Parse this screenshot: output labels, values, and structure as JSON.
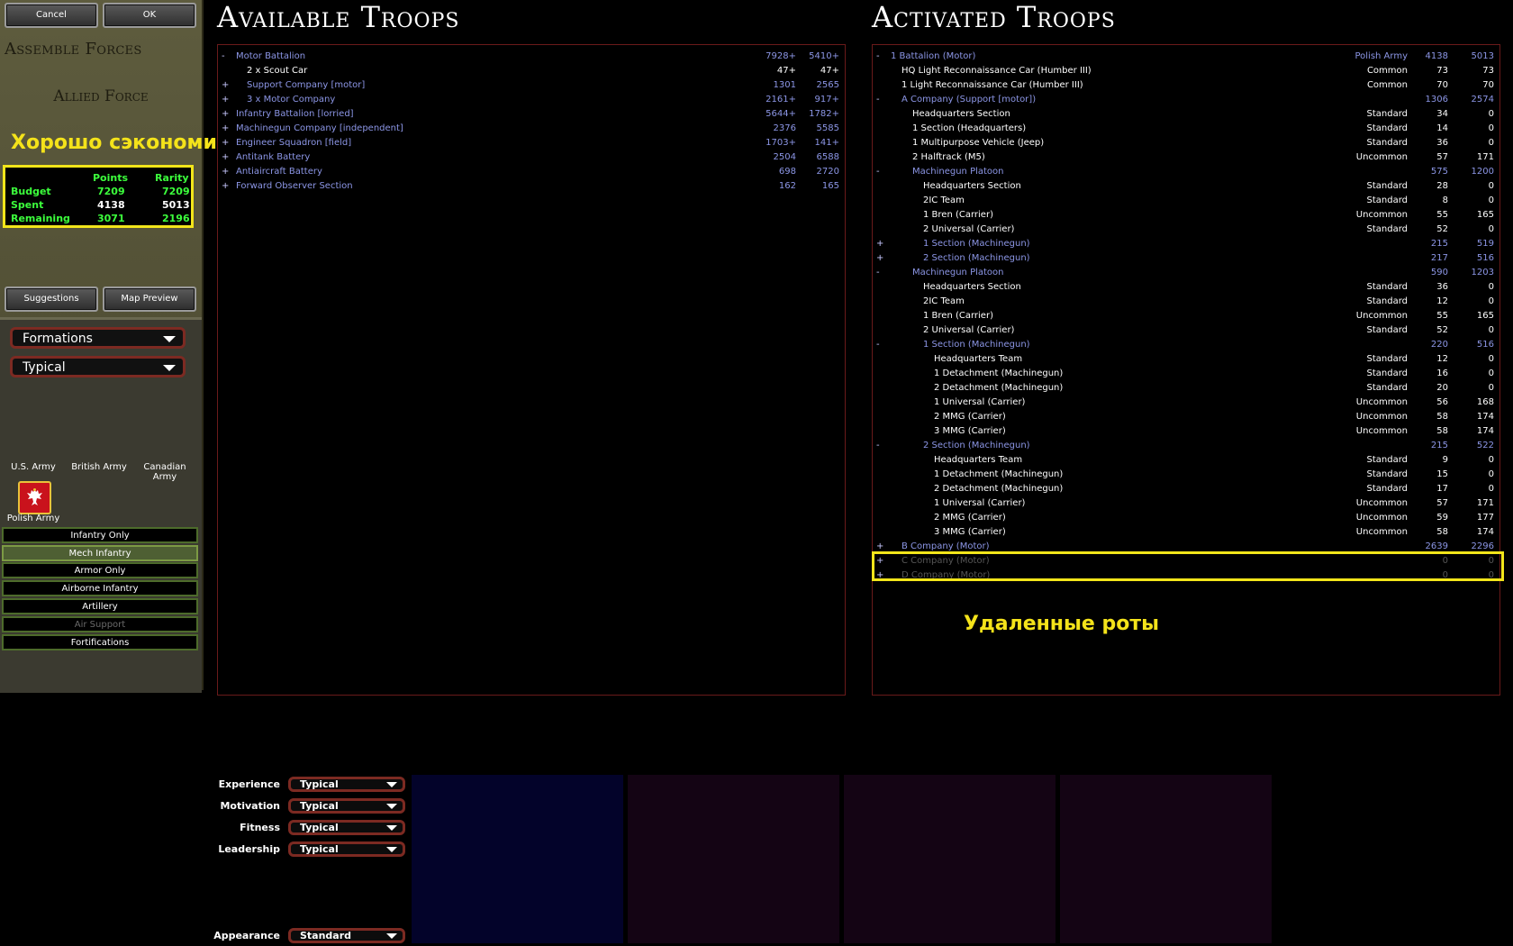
{
  "buttons": {
    "cancel": "Cancel",
    "ok": "OK",
    "suggestions": "Suggestions",
    "map_preview": "Map Preview"
  },
  "left": {
    "assemble_title": "Assemble Forces",
    "force_title": "Allied Force",
    "budget": {
      "col_points": "Points",
      "col_rarity": "Rarity",
      "rows": [
        {
          "label": "Budget",
          "points": "7209",
          "rarity": "7209"
        },
        {
          "label": "Spent",
          "points": "4138",
          "rarity": "5013"
        },
        {
          "label": "Remaining",
          "points": "3071",
          "rarity": "2196"
        }
      ]
    },
    "dropdown_type": "Formations",
    "dropdown_quality": "Typical",
    "armies": [
      "U.S. Army",
      "British Army",
      "Canadian Army",
      "Polish Army"
    ],
    "categories": [
      "Infantry Only",
      "Mech Infantry",
      "Armor Only",
      "Airborne Infantry",
      "Artillery",
      "Air Support",
      "Fortifications"
    ]
  },
  "overlays": {
    "saved": "Хорошо сэкономили",
    "deleted": "Удаленные роты"
  },
  "available": {
    "title": "Available Troops",
    "rows": [
      {
        "sign": "-",
        "indent": 0,
        "name": "Motor Battalion",
        "v1": "7928+",
        "v2": "5410+",
        "style": "blue"
      },
      {
        "sign": "",
        "indent": 1,
        "name": "2 x Scout Car",
        "v1": "47+",
        "v2": "47+",
        "style": "lt"
      },
      {
        "sign": "+",
        "indent": 1,
        "name": "Support Company [motor]",
        "v1": "1301",
        "v2": "2565",
        "style": "blue"
      },
      {
        "sign": "+",
        "indent": 1,
        "name": "3 x Motor Company",
        "v1": "2161+",
        "v2": "917+",
        "style": "blue"
      },
      {
        "sign": "+",
        "indent": 0,
        "name": "Infantry Battalion [lorried]",
        "v1": "5644+",
        "v2": "1782+",
        "style": "blue"
      },
      {
        "sign": "+",
        "indent": 0,
        "name": "Machinegun Company [independent]",
        "v1": "2376",
        "v2": "5585",
        "style": "blue"
      },
      {
        "sign": "+",
        "indent": 0,
        "name": "Engineer Squadron [field]",
        "v1": "1703+",
        "v2": "141+",
        "style": "blue"
      },
      {
        "sign": "+",
        "indent": 0,
        "name": "Antitank Battery",
        "v1": "2504",
        "v2": "6588",
        "style": "blue"
      },
      {
        "sign": "+",
        "indent": 0,
        "name": "Antiaircraft Battery",
        "v1": "698",
        "v2": "2720",
        "style": "blue"
      },
      {
        "sign": "+",
        "indent": 0,
        "name": "Forward Observer Section",
        "v1": "162",
        "v2": "165",
        "style": "blue"
      }
    ]
  },
  "activated": {
    "title": "Activated Troops",
    "rows": [
      {
        "sign": "-",
        "indent": 0,
        "name": "1 Battalion (Motor)",
        "rarity": "Polish Army",
        "v1": "4138",
        "v2": "5013",
        "style": "blue"
      },
      {
        "sign": "",
        "indent": 1,
        "name": "HQ Light Reconnaissance Car (Humber III)",
        "rarity": "Common",
        "v1": "73",
        "v2": "73",
        "style": "lt"
      },
      {
        "sign": "",
        "indent": 1,
        "name": "1 Light Reconnaissance Car (Humber III)",
        "rarity": "Common",
        "v1": "70",
        "v2": "70",
        "style": "lt"
      },
      {
        "sign": "-",
        "indent": 1,
        "name": "A Company (Support [motor])",
        "rarity": "",
        "v1": "1306",
        "v2": "2574",
        "style": "blue"
      },
      {
        "sign": "",
        "indent": 2,
        "name": "Headquarters Section",
        "rarity": "Standard",
        "v1": "34",
        "v2": "0",
        "style": "lt"
      },
      {
        "sign": "",
        "indent": 2,
        "name": "1 Section (Headquarters)",
        "rarity": "Standard",
        "v1": "14",
        "v2": "0",
        "style": "lt"
      },
      {
        "sign": "",
        "indent": 2,
        "name": "1 Multipurpose Vehicle (Jeep)",
        "rarity": "Standard",
        "v1": "36",
        "v2": "0",
        "style": "lt"
      },
      {
        "sign": "",
        "indent": 2,
        "name": "2 Halftrack (M5)",
        "rarity": "Uncommon",
        "v1": "57",
        "v2": "171",
        "style": "lt"
      },
      {
        "sign": "-",
        "indent": 2,
        "name": "Machinegun Platoon",
        "rarity": "",
        "v1": "575",
        "v2": "1200",
        "style": "blue"
      },
      {
        "sign": "",
        "indent": 3,
        "name": "Headquarters Section",
        "rarity": "Standard",
        "v1": "28",
        "v2": "0",
        "style": "lt"
      },
      {
        "sign": "",
        "indent": 3,
        "name": "2IC Team",
        "rarity": "Standard",
        "v1": "8",
        "v2": "0",
        "style": "lt"
      },
      {
        "sign": "",
        "indent": 3,
        "name": "1 Bren (Carrier)",
        "rarity": "Uncommon",
        "v1": "55",
        "v2": "165",
        "style": "lt"
      },
      {
        "sign": "",
        "indent": 3,
        "name": "2 Universal (Carrier)",
        "rarity": "Standard",
        "v1": "52",
        "v2": "0",
        "style": "lt"
      },
      {
        "sign": "+",
        "indent": 3,
        "name": "1 Section (Machinegun)",
        "rarity": "",
        "v1": "215",
        "v2": "519",
        "style": "blue"
      },
      {
        "sign": "+",
        "indent": 3,
        "name": "2 Section (Machinegun)",
        "rarity": "",
        "v1": "217",
        "v2": "516",
        "style": "blue"
      },
      {
        "sign": "-",
        "indent": 2,
        "name": "Machinegun Platoon",
        "rarity": "",
        "v1": "590",
        "v2": "1203",
        "style": "blue"
      },
      {
        "sign": "",
        "indent": 3,
        "name": "Headquarters Section",
        "rarity": "Standard",
        "v1": "36",
        "v2": "0",
        "style": "lt"
      },
      {
        "sign": "",
        "indent": 3,
        "name": "2IC Team",
        "rarity": "Standard",
        "v1": "12",
        "v2": "0",
        "style": "lt"
      },
      {
        "sign": "",
        "indent": 3,
        "name": "1 Bren (Carrier)",
        "rarity": "Uncommon",
        "v1": "55",
        "v2": "165",
        "style": "lt"
      },
      {
        "sign": "",
        "indent": 3,
        "name": "2 Universal (Carrier)",
        "rarity": "Standard",
        "v1": "52",
        "v2": "0",
        "style": "lt"
      },
      {
        "sign": "-",
        "indent": 3,
        "name": "1 Section (Machinegun)",
        "rarity": "",
        "v1": "220",
        "v2": "516",
        "style": "blue"
      },
      {
        "sign": "",
        "indent": 4,
        "name": "Headquarters Team",
        "rarity": "Standard",
        "v1": "12",
        "v2": "0",
        "style": "lt"
      },
      {
        "sign": "",
        "indent": 4,
        "name": "1 Detachment (Machinegun)",
        "rarity": "Standard",
        "v1": "16",
        "v2": "0",
        "style": "lt"
      },
      {
        "sign": "",
        "indent": 4,
        "name": "2 Detachment (Machinegun)",
        "rarity": "Standard",
        "v1": "20",
        "v2": "0",
        "style": "lt"
      },
      {
        "sign": "",
        "indent": 4,
        "name": "1 Universal (Carrier)",
        "rarity": "Uncommon",
        "v1": "56",
        "v2": "168",
        "style": "lt"
      },
      {
        "sign": "",
        "indent": 4,
        "name": "2 MMG (Carrier)",
        "rarity": "Uncommon",
        "v1": "58",
        "v2": "174",
        "style": "lt"
      },
      {
        "sign": "",
        "indent": 4,
        "name": "3 MMG (Carrier)",
        "rarity": "Uncommon",
        "v1": "58",
        "v2": "174",
        "style": "lt"
      },
      {
        "sign": "-",
        "indent": 3,
        "name": "2 Section (Machinegun)",
        "rarity": "",
        "v1": "215",
        "v2": "522",
        "style": "blue"
      },
      {
        "sign": "",
        "indent": 4,
        "name": "Headquarters Team",
        "rarity": "Standard",
        "v1": "9",
        "v2": "0",
        "style": "lt"
      },
      {
        "sign": "",
        "indent": 4,
        "name": "1 Detachment (Machinegun)",
        "rarity": "Standard",
        "v1": "15",
        "v2": "0",
        "style": "lt"
      },
      {
        "sign": "",
        "indent": 4,
        "name": "2 Detachment (Machinegun)",
        "rarity": "Standard",
        "v1": "17",
        "v2": "0",
        "style": "lt"
      },
      {
        "sign": "",
        "indent": 4,
        "name": "1 Universal (Carrier)",
        "rarity": "Uncommon",
        "v1": "57",
        "v2": "171",
        "style": "lt"
      },
      {
        "sign": "",
        "indent": 4,
        "name": "2 MMG (Carrier)",
        "rarity": "Uncommon",
        "v1": "59",
        "v2": "177",
        "style": "lt"
      },
      {
        "sign": "",
        "indent": 4,
        "name": "3 MMG (Carrier)",
        "rarity": "Uncommon",
        "v1": "58",
        "v2": "174",
        "style": "lt"
      },
      {
        "sign": "+",
        "indent": 1,
        "name": "B Company (Motor)",
        "rarity": "",
        "v1": "2639",
        "v2": "2296",
        "style": "blue"
      },
      {
        "sign": "+",
        "indent": 1,
        "name": "C Company (Motor)",
        "rarity": "",
        "v1": "0",
        "v2": "0",
        "style": "grey"
      },
      {
        "sign": "+",
        "indent": 1,
        "name": "D Company (Motor)",
        "rarity": "",
        "v1": "0",
        "v2": "0",
        "style": "grey"
      }
    ]
  },
  "settings": [
    {
      "label": "Experience",
      "value": "Typical"
    },
    {
      "label": "Motivation",
      "value": "Typical"
    },
    {
      "label": "Fitness",
      "value": "Typical"
    },
    {
      "label": "Leadership",
      "value": "Typical"
    },
    {
      "label": "Appearance",
      "value": "Standard"
    }
  ],
  "colors": {
    "accent_green": "#3cff3c",
    "highlight_yellow": "#f2e51a",
    "tree_blue": "#8c96e6",
    "panel_border": "#6a1a1a",
    "preview_1": "#03032a",
    "preview_2": "#140414",
    "preview_3": "#140414",
    "preview_4": "#140414"
  }
}
